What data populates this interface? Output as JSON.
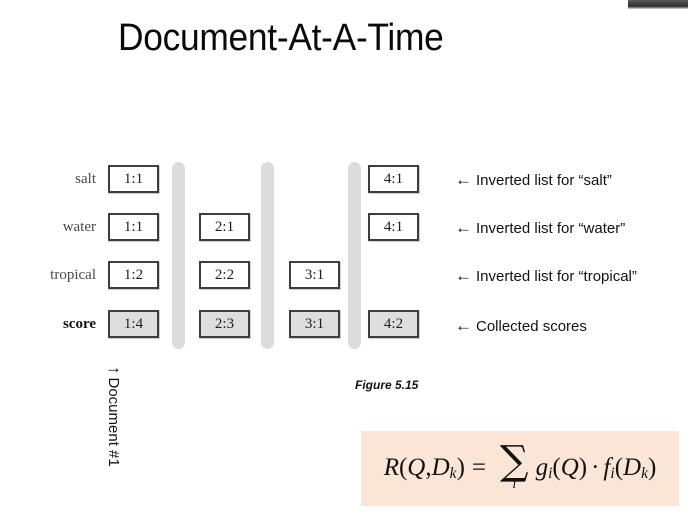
{
  "slide": {
    "title": "Document-At-A-Time",
    "figure_caption": "Figure 5.15",
    "vertical_axis_label": "Document #1",
    "vertical_axis_arrow": "↑"
  },
  "diagram": {
    "rows": [
      {
        "label": "salt",
        "is_score_row": false,
        "annotation_arrow": "←",
        "annotation": "Inverted list for “salt”",
        "cells": [
          {
            "column": 1,
            "value": "1:1",
            "present": true
          },
          {
            "column": 2,
            "value": "",
            "present": false
          },
          {
            "column": 3,
            "value": "",
            "present": false
          },
          {
            "column": 4,
            "value": "4:1",
            "present": true
          }
        ]
      },
      {
        "label": "water",
        "is_score_row": false,
        "annotation_arrow": "←",
        "annotation": "Inverted list for “water”",
        "cells": [
          {
            "column": 1,
            "value": "1:1",
            "present": true
          },
          {
            "column": 2,
            "value": "2:1",
            "present": true
          },
          {
            "column": 3,
            "value": "",
            "present": false
          },
          {
            "column": 4,
            "value": "4:1",
            "present": true
          }
        ]
      },
      {
        "label": "tropical",
        "is_score_row": false,
        "annotation_arrow": "←",
        "annotation": "Inverted list for “tropical”",
        "cells": [
          {
            "column": 1,
            "value": "1:2",
            "present": true
          },
          {
            "column": 2,
            "value": "2:2",
            "present": true
          },
          {
            "column": 3,
            "value": "3:1",
            "present": true
          },
          {
            "column": 4,
            "value": "",
            "present": false
          }
        ]
      },
      {
        "label": "score",
        "is_score_row": true,
        "annotation_arrow": "←",
        "annotation": "Collected scores",
        "cells": [
          {
            "column": 1,
            "value": "1:4",
            "present": true
          },
          {
            "column": 2,
            "value": "2:3",
            "present": true
          },
          {
            "column": 3,
            "value": "3:1",
            "present": true
          },
          {
            "column": 4,
            "value": "4:2",
            "present": true
          }
        ]
      }
    ],
    "separator_bar_count": 3,
    "colors": {
      "box_border": "#3d3d3d",
      "score_fill": "#dedede",
      "separator_bar": "#dcdcdc"
    }
  },
  "formula": {
    "lhs_fn": "R",
    "lhs_args_open": "(",
    "lhs_q": "Q",
    "lhs_comma": ", ",
    "lhs_d": "D",
    "lhs_d_sub": "k",
    "lhs_args_close": ")",
    "equals": "=",
    "sigma": "∑",
    "sigma_index": "i",
    "g": "g",
    "g_sub": "i",
    "g_open": "(",
    "g_arg": "Q",
    "g_close": ")",
    "dot": "·",
    "f": "f",
    "f_sub": "i",
    "f_open": "(",
    "f_arg": "D",
    "f_arg_sub": "k",
    "f_close": ")",
    "background_color": "#fbe5d6"
  }
}
